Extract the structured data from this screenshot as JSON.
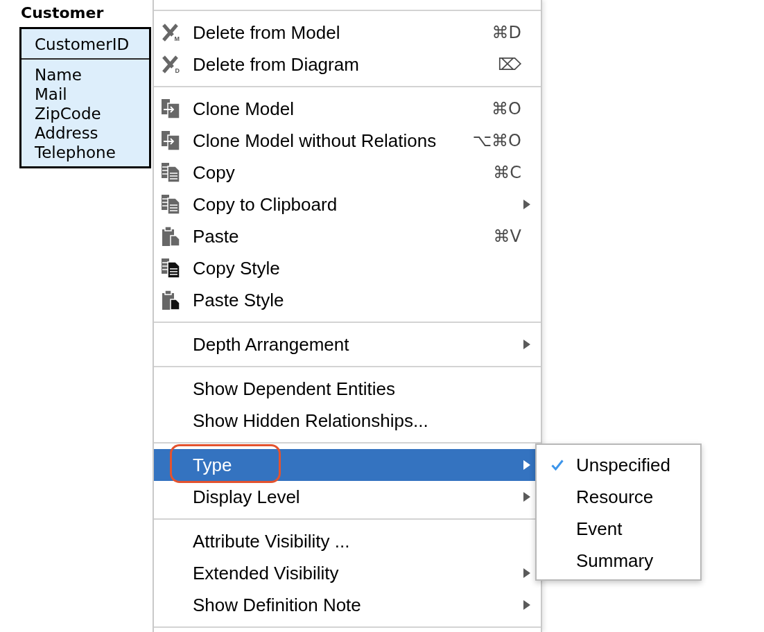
{
  "entity": {
    "title": "Customer",
    "key_attributes": [
      "CustomerID"
    ],
    "attributes": [
      "Name",
      "Mail",
      "ZipCode",
      "Address",
      "Telephone"
    ]
  },
  "context_menu": {
    "items": [
      {
        "kind": "separator"
      },
      {
        "kind": "delete",
        "label": "Delete from Model",
        "icon_letter": "M",
        "shortcut": "⌘D",
        "submenu": false,
        "selected": false,
        "annotated": false
      },
      {
        "kind": "delete",
        "label": "Delete from Diagram",
        "icon_letter": "D",
        "shortcut": "⌦",
        "submenu": false,
        "selected": false,
        "annotated": false
      },
      {
        "kind": "separator"
      },
      {
        "kind": "clone",
        "label": "Clone Model",
        "shortcut": "⌘O",
        "submenu": false,
        "selected": false,
        "annotated": false
      },
      {
        "kind": "clone",
        "label": "Clone Model without Relations",
        "shortcut": "⌥⌘O",
        "submenu": false,
        "selected": false,
        "annotated": false
      },
      {
        "kind": "copy",
        "label": "Copy",
        "shortcut": "⌘C",
        "submenu": false,
        "selected": false,
        "annotated": false
      },
      {
        "kind": "copy",
        "label": "Copy to Clipboard",
        "submenu": true,
        "selected": false,
        "annotated": false
      },
      {
        "kind": "paste",
        "label": "Paste",
        "shortcut": "⌘V",
        "submenu": false,
        "selected": false,
        "annotated": false
      },
      {
        "kind": "copystyle",
        "label": "Copy Style",
        "submenu": false,
        "selected": false,
        "annotated": false
      },
      {
        "kind": "pastestyle",
        "label": "Paste Style",
        "submenu": false,
        "selected": false,
        "annotated": false
      },
      {
        "kind": "separator"
      },
      {
        "kind": "plain",
        "label": "Depth Arrangement",
        "submenu": true,
        "selected": false,
        "annotated": false
      },
      {
        "kind": "separator"
      },
      {
        "kind": "plain",
        "label": "Show Dependent Entities",
        "submenu": false,
        "selected": false,
        "annotated": false
      },
      {
        "kind": "plain",
        "label": "Show Hidden Relationships...",
        "submenu": false,
        "selected": false,
        "annotated": false
      },
      {
        "kind": "separator"
      },
      {
        "kind": "plain",
        "label": "Type",
        "submenu": true,
        "selected": true,
        "annotated": true
      },
      {
        "kind": "plain",
        "label": "Display Level",
        "submenu": true,
        "selected": false,
        "annotated": false
      },
      {
        "kind": "separator"
      },
      {
        "kind": "plain",
        "label": "Attribute Visibility ...",
        "submenu": false,
        "selected": false,
        "annotated": false
      },
      {
        "kind": "plain",
        "label": "Extended Visibility",
        "submenu": true,
        "selected": false,
        "annotated": false
      },
      {
        "kind": "plain",
        "label": "Show Definition Note",
        "submenu": true,
        "selected": false,
        "annotated": false
      },
      {
        "kind": "separator"
      }
    ]
  },
  "submenu": {
    "items": [
      {
        "label": "Unspecified",
        "checked": true
      },
      {
        "label": "Resource",
        "checked": false
      },
      {
        "label": "Event",
        "checked": false
      },
      {
        "label": "Summary",
        "checked": false
      }
    ]
  }
}
